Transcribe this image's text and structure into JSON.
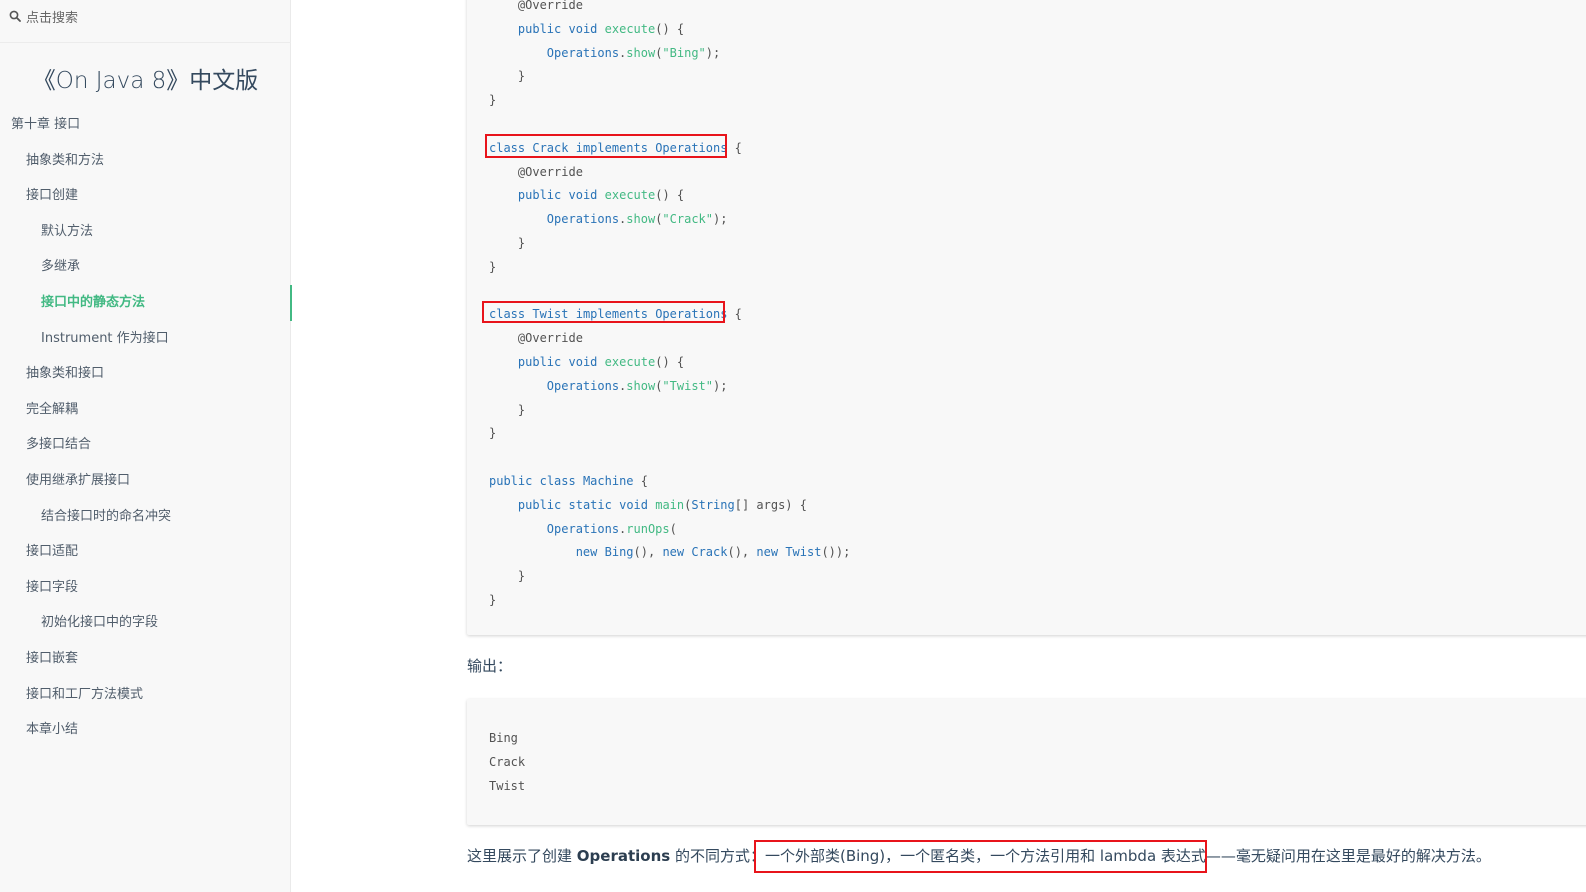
{
  "search": {
    "placeholder": "点击搜索",
    "icon": "search-icon"
  },
  "sidebar": {
    "app_name": "《On Java 8》中文版",
    "items": [
      {
        "label": "第十章 接口",
        "level": 0
      },
      {
        "label": "抽象类和方法",
        "level": 1
      },
      {
        "label": "接口创建",
        "level": 1
      },
      {
        "label": "默认方法",
        "level": 2
      },
      {
        "label": "多继承",
        "level": 2
      },
      {
        "label": "接口中的静态方法",
        "level": 2,
        "active": true
      },
      {
        "label": "Instrument 作为接口",
        "level": 2
      },
      {
        "label": "抽象类和接口",
        "level": 1
      },
      {
        "label": "完全解耦",
        "level": 1
      },
      {
        "label": "多接口结合",
        "level": 1
      },
      {
        "label": "使用继承扩展接口",
        "level": 1
      },
      {
        "label": "结合接口时的命名冲突",
        "level": 2
      },
      {
        "label": "接口适配",
        "level": 1
      },
      {
        "label": "接口字段",
        "level": 1
      },
      {
        "label": "初始化接口中的字段",
        "level": 2
      },
      {
        "label": "接口嵌套",
        "level": 1
      },
      {
        "label": "接口和工厂方法模式",
        "level": 1
      },
      {
        "label": "本章小结",
        "level": 1
      }
    ],
    "active_color": "#42b983"
  },
  "code_main": {
    "lines": [
      [
        "    ",
        {
          "t": "@Override",
          "c": "anno"
        }
      ],
      [
        "    ",
        {
          "t": "public",
          "c": "kw"
        },
        " ",
        {
          "t": "void",
          "c": "kw"
        },
        " ",
        {
          "t": "execute",
          "c": "fn"
        },
        "() {"
      ],
      [
        "        ",
        {
          "t": "Operations",
          "c": "cls"
        },
        ".",
        {
          "t": "show",
          "c": "fn"
        },
        "(",
        {
          "t": "\"Bing\"",
          "c": "str"
        },
        ");"
      ],
      [
        "    }"
      ],
      [
        "}"
      ],
      [
        ""
      ],
      [
        {
          "t": "class",
          "c": "kw"
        },
        " ",
        {
          "t": "Crack",
          "c": "cls"
        },
        " ",
        {
          "t": "implements",
          "c": "kw"
        },
        " ",
        {
          "t": "Operations",
          "c": "cls"
        },
        " {"
      ],
      [
        "    ",
        {
          "t": "@Override",
          "c": "anno"
        }
      ],
      [
        "    ",
        {
          "t": "public",
          "c": "kw"
        },
        " ",
        {
          "t": "void",
          "c": "kw"
        },
        " ",
        {
          "t": "execute",
          "c": "fn"
        },
        "() {"
      ],
      [
        "        ",
        {
          "t": "Operations",
          "c": "cls"
        },
        ".",
        {
          "t": "show",
          "c": "fn"
        },
        "(",
        {
          "t": "\"Crack\"",
          "c": "str"
        },
        ");"
      ],
      [
        "    }"
      ],
      [
        "}"
      ],
      [
        ""
      ],
      [
        {
          "t": "class",
          "c": "kw"
        },
        " ",
        {
          "t": "Twist",
          "c": "cls"
        },
        " ",
        {
          "t": "implements",
          "c": "kw"
        },
        " ",
        {
          "t": "Operations",
          "c": "cls"
        },
        " {"
      ],
      [
        "    ",
        {
          "t": "@Override",
          "c": "anno"
        }
      ],
      [
        "    ",
        {
          "t": "public",
          "c": "kw"
        },
        " ",
        {
          "t": "void",
          "c": "kw"
        },
        " ",
        {
          "t": "execute",
          "c": "fn"
        },
        "() {"
      ],
      [
        "        ",
        {
          "t": "Operations",
          "c": "cls"
        },
        ".",
        {
          "t": "show",
          "c": "fn"
        },
        "(",
        {
          "t": "\"Twist\"",
          "c": "str"
        },
        ");"
      ],
      [
        "    }"
      ],
      [
        "}"
      ],
      [
        ""
      ],
      [
        {
          "t": "public",
          "c": "kw"
        },
        " ",
        {
          "t": "class",
          "c": "kw"
        },
        " ",
        {
          "t": "Machine",
          "c": "cls"
        },
        " {"
      ],
      [
        "    ",
        {
          "t": "public",
          "c": "kw"
        },
        " ",
        {
          "t": "static",
          "c": "kw"
        },
        " ",
        {
          "t": "void",
          "c": "kw"
        },
        " ",
        {
          "t": "main",
          "c": "fn"
        },
        "(",
        {
          "t": "String",
          "c": "cls"
        },
        "[] args) {"
      ],
      [
        "        ",
        {
          "t": "Operations",
          "c": "cls"
        },
        ".",
        {
          "t": "runOps",
          "c": "fn"
        },
        "("
      ],
      [
        "            ",
        {
          "t": "new",
          "c": "kw"
        },
        " ",
        {
          "t": "Bing",
          "c": "cls"
        },
        "(), ",
        {
          "t": "new",
          "c": "kw"
        },
        " ",
        {
          "t": "Crack",
          "c": "cls"
        },
        "(), ",
        {
          "t": "new",
          "c": "kw"
        },
        " ",
        {
          "t": "Twist",
          "c": "cls"
        },
        "());"
      ],
      [
        "    }"
      ],
      [
        "}"
      ]
    ]
  },
  "output_label": "输出：",
  "code_output": {
    "lines": [
      [
        "Bing"
      ],
      [
        "Crack"
      ],
      [
        "Twist"
      ]
    ]
  },
  "paragraph": {
    "prefix": "这里展示了创建 ",
    "bold": "Operations",
    "middle": " 的不同方式：",
    "highlighted": "一个外部类(Bing)，一个匿名类，一个方法引用和 lambda 表达式",
    "suffix": "——毫无疑问用在这里是最好的解决方法。"
  },
  "colors": {
    "highlight_box": "#e8141b",
    "keyword": "#2973b7",
    "string": "#42b983"
  }
}
